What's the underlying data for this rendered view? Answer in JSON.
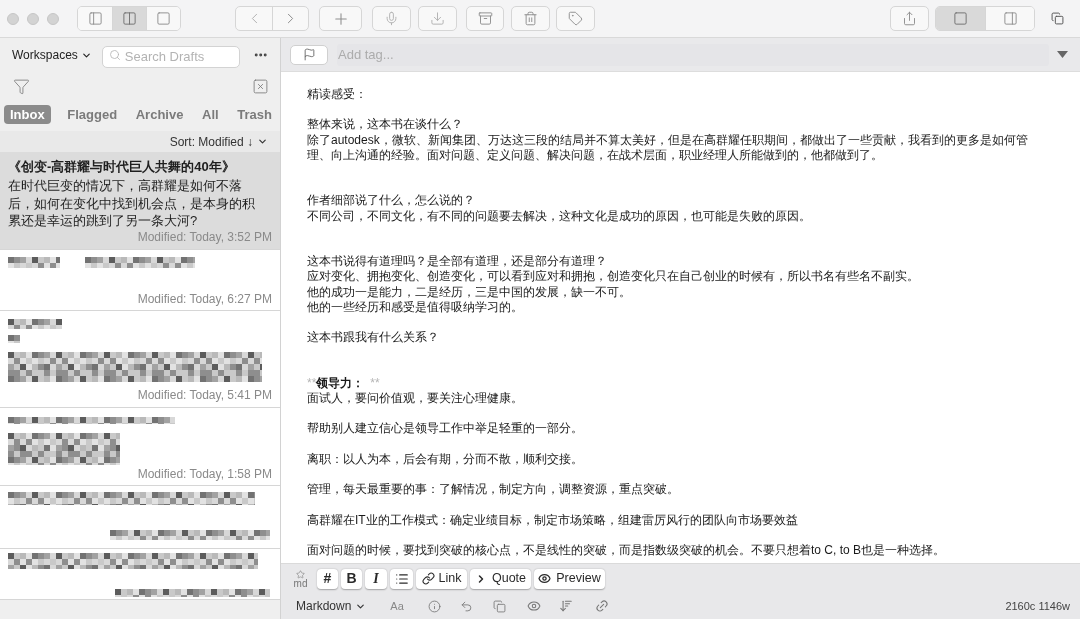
{
  "toolbar": {
    "view_modes": [
      {
        "selected": false
      },
      {
        "selected": true
      },
      {
        "selected": false
      }
    ],
    "layout_modes": [
      {
        "selected": true
      },
      {
        "selected": false
      }
    ]
  },
  "sidebar": {
    "workspaces": "Workspaces",
    "search": {
      "placeholder": "Search Drafts"
    },
    "tabs": [
      {
        "label": "Inbox",
        "selected": true
      },
      {
        "label": "Flagged",
        "selected": false
      },
      {
        "label": "Archive",
        "selected": false
      },
      {
        "label": "All",
        "selected": false
      },
      {
        "label": "Trash",
        "selected": false
      }
    ],
    "sort": "Sort: Modified ↓",
    "drafts": [
      {
        "kind": "text",
        "title": "《创变-高群耀与时代巨人共舞的40年》",
        "excerpt": "在时代巨变的情况下，高群耀是如何不落后，如何在变化中找到机会点，是本身的积累还是幸运的跳到了另一条大河?",
        "modified": "Modified: Today, 3:52 PM",
        "selected": true
      },
      {
        "kind": "pixelated",
        "modified": "Modified: Today, 6:27 PM",
        "selected": false
      },
      {
        "kind": "pixelated",
        "modified": "Modified: Today, 5:41 PM",
        "selected": false
      },
      {
        "kind": "pixelated",
        "modified": "Modified: Today, 1:58 PM",
        "selected": false
      },
      {
        "kind": "pixelated",
        "selected": false
      },
      {
        "kind": "pixelated",
        "selected": false
      }
    ]
  },
  "editor": {
    "tag_placeholder": "Add tag...",
    "lines": [
      {
        "kind": "text",
        "text": "精读感受："
      },
      {
        "kind": "blank"
      },
      {
        "kind": "text",
        "text": "整体来说，这本书在谈什么？"
      },
      {
        "kind": "wrapped",
        "lines": [
          "除了autodesk，微软、新闻集团、万达这三段的结局并不算太美好，但是在高群耀任职期间，都做出了一些贡献，我看到的更多是如何管",
          "理、向上沟通的经验。面对问题、定义问题、解决问题，在战术层面，职业经理人所能做到的，他都做到了。"
        ]
      },
      {
        "kind": "blank"
      },
      {
        "kind": "blank"
      },
      {
        "kind": "text",
        "text": "作者细部说了什么，怎么说的？"
      },
      {
        "kind": "text",
        "text": "不同公司，不同文化，有不同的问题要去解决，这种文化是成功的原因，也可能是失败的原因。"
      },
      {
        "kind": "blank"
      },
      {
        "kind": "blank"
      },
      {
        "kind": "text",
        "text": "这本书说得有道理吗？是全部有道理，还是部分有道理？"
      },
      {
        "kind": "text",
        "text": "应对变化、拥抱变化、创造变化，可以看到应对和拥抱，创造变化只在自己创业的时候有，所以书名有些名不副实。"
      },
      {
        "kind": "text",
        "text": "他的成功一是能力，二是经历，三是中国的发展，缺一不可。"
      },
      {
        "kind": "text",
        "text": "他的一些经历和感受是值得吸纳学习的。"
      },
      {
        "kind": "blank"
      },
      {
        "kind": "text",
        "text": "这本书跟我有什么关系？"
      },
      {
        "kind": "blank"
      },
      {
        "kind": "blank"
      },
      {
        "kind": "strong",
        "open_marker": "**",
        "text": "领导力：",
        "close_marker": "**"
      },
      {
        "kind": "text",
        "text": "面试人，要问价值观，要关注心理健康。"
      },
      {
        "kind": "blank"
      },
      {
        "kind": "text",
        "text": "帮助别人建立信心是领导工作中举足轻重的一部分。"
      },
      {
        "kind": "blank"
      },
      {
        "kind": "text",
        "text": "离职：以人为本，后会有期，分而不散，顺利交接。"
      },
      {
        "kind": "blank"
      },
      {
        "kind": "text",
        "text": "管理，每天最重要的事：了解情况，制定方向，调整资源，重点突破。"
      },
      {
        "kind": "blank"
      },
      {
        "kind": "text",
        "text": "高群耀在IT业的工作模式：确定业绩目标，制定市场策略，组建雷厉风行的团队向市场要效益"
      },
      {
        "kind": "blank"
      },
      {
        "kind": "text",
        "text": "面对问题的时候，要找到突破的核心点，不是线性的突破，而是指数级突破的机会。不要只想着to C, to B也是一种选择。"
      }
    ]
  },
  "format_bar": {
    "syntax_badge": "md",
    "buttons": [
      {
        "kind": "hash",
        "label": "#"
      },
      {
        "kind": "bold",
        "label": "B"
      },
      {
        "kind": "italic",
        "label": "I"
      },
      {
        "kind": "list"
      },
      {
        "kind": "link",
        "label": "Link"
      },
      {
        "kind": "quote",
        "label": "Quote"
      },
      {
        "kind": "preview",
        "label": "Preview"
      }
    ]
  },
  "status_bar": {
    "syntax": "Markdown",
    "font": "Aa",
    "counts": "2160c 1146w"
  }
}
